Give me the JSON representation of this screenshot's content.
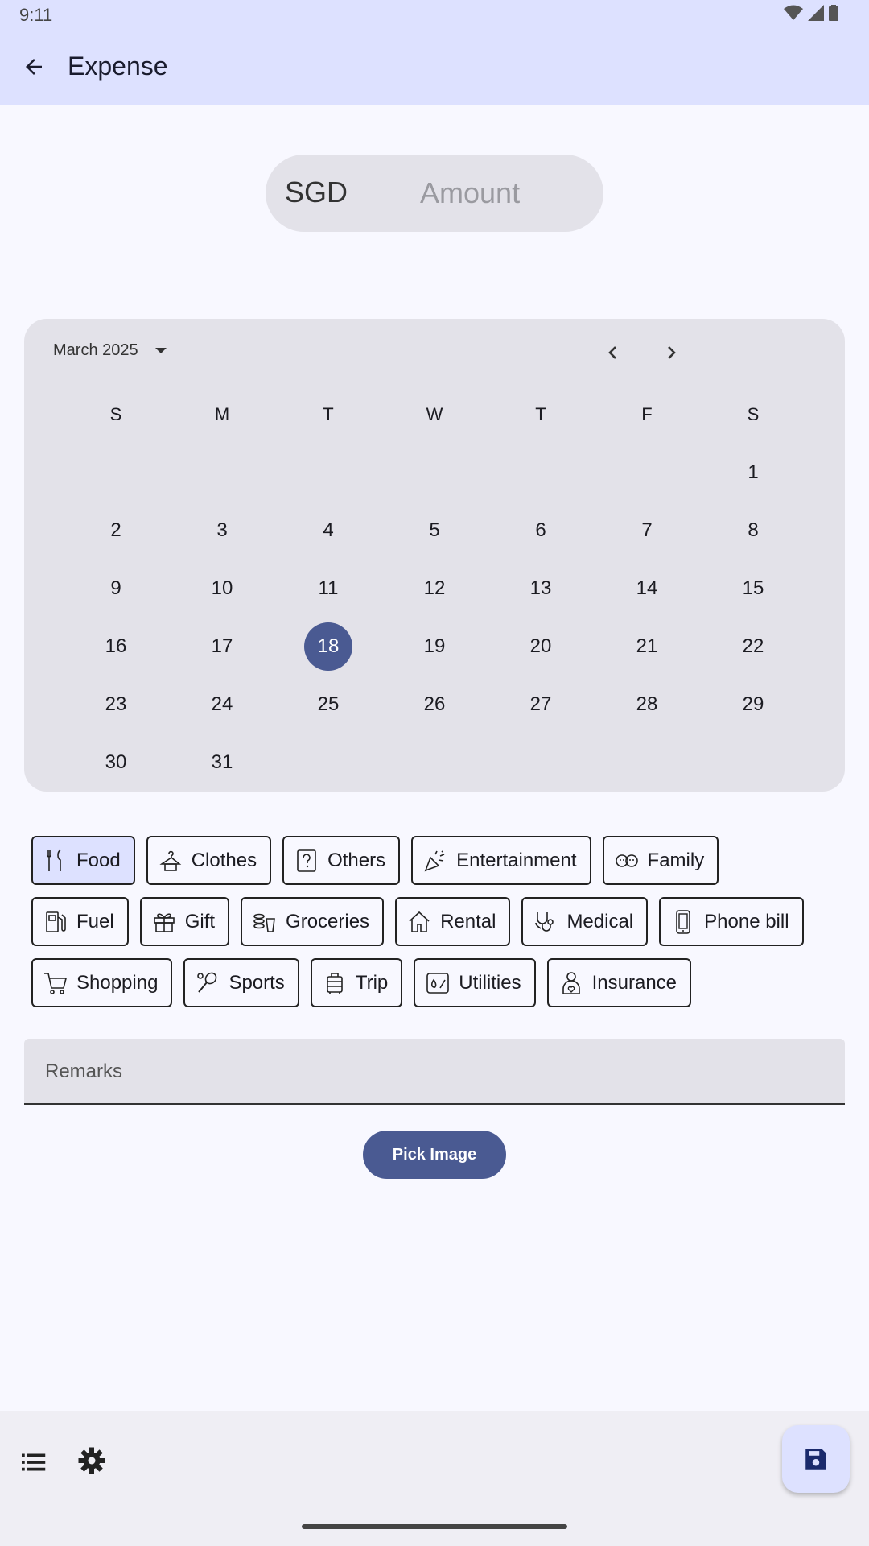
{
  "status_bar": {
    "time": "9:11"
  },
  "app_bar": {
    "title": "Expense"
  },
  "amount": {
    "currency": "SGD",
    "placeholder": "Amount"
  },
  "calendar": {
    "month_label": "March 2025",
    "weekdays": [
      "S",
      "M",
      "T",
      "W",
      "T",
      "F",
      "S"
    ],
    "selected_day": "18",
    "weeks": [
      [
        "",
        "",
        "",
        "",
        "",
        "",
        "1"
      ],
      [
        "2",
        "3",
        "4",
        "5",
        "6",
        "7",
        "8"
      ],
      [
        "9",
        "10",
        "11",
        "12",
        "13",
        "14",
        "15"
      ],
      [
        "16",
        "17",
        "18",
        "19",
        "20",
        "21",
        "22"
      ],
      [
        "23",
        "24",
        "25",
        "26",
        "27",
        "28",
        "29"
      ],
      [
        "30",
        "31",
        "",
        "",
        "",
        "",
        ""
      ]
    ]
  },
  "categories": {
    "selected": "Food",
    "rows": [
      [
        {
          "label": "Food",
          "icon": "fork-knife-icon"
        },
        {
          "label": "Clothes",
          "icon": "hanger-icon"
        },
        {
          "label": "Others",
          "icon": "question-icon"
        },
        {
          "label": "Entertainment",
          "icon": "party-popper-icon"
        },
        {
          "label": "Family",
          "icon": "family-icon"
        }
      ],
      [
        {
          "label": "Fuel",
          "icon": "fuel-pump-icon"
        },
        {
          "label": "Gift",
          "icon": "gift-icon"
        },
        {
          "label": "Groceries",
          "icon": "groceries-icon"
        },
        {
          "label": "Rental",
          "icon": "house-icon"
        },
        {
          "label": "Medical",
          "icon": "stethoscope-icon"
        },
        {
          "label": "Phone bill",
          "icon": "phone-icon"
        }
      ],
      [
        {
          "label": "Shopping",
          "icon": "cart-icon"
        },
        {
          "label": "Sports",
          "icon": "racket-icon"
        },
        {
          "label": "Trip",
          "icon": "luggage-icon"
        },
        {
          "label": "Utilities",
          "icon": "utilities-icon"
        },
        {
          "label": "Insurance",
          "icon": "insurance-icon"
        }
      ]
    ]
  },
  "remarks": {
    "placeholder": "Remarks"
  },
  "pick_image": {
    "label": "Pick Image"
  },
  "colors": {
    "accent": "#4a5a92",
    "surface": "#e3e2e9",
    "appbar": "#dde1ff",
    "background": "#f8f8ff"
  }
}
